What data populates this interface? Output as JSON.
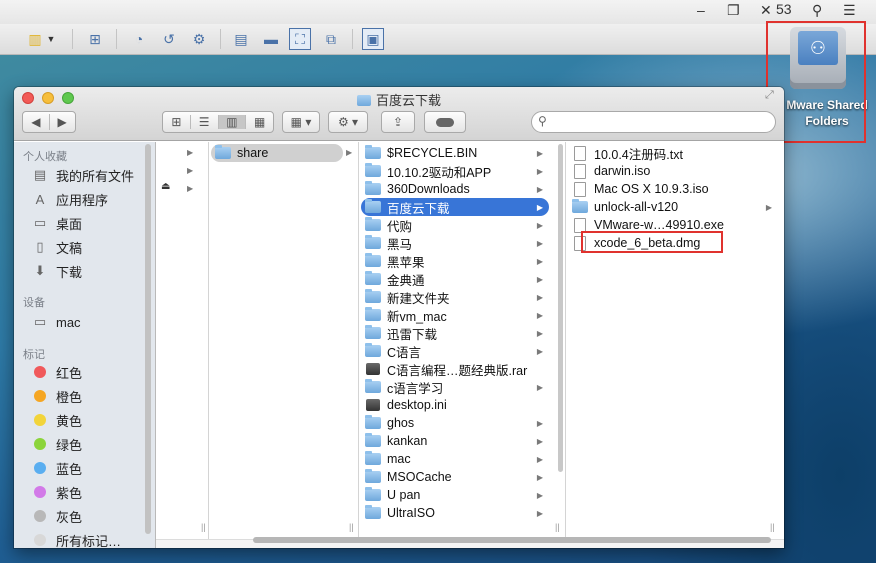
{
  "host": {
    "titlebar_fragment": "53",
    "window_controls": [
      "minimize-icon",
      "restore-icon",
      "close-icon"
    ]
  },
  "desktop_icon": {
    "label_line1": "Mware Shared",
    "label_line2": "Folders"
  },
  "finder": {
    "title": "百度云下载",
    "sidebar": {
      "favorites_heading": "个人收藏",
      "favorites": [
        {
          "label": "我的所有文件",
          "icon": "all-files-icon"
        },
        {
          "label": "应用程序",
          "icon": "applications-icon"
        },
        {
          "label": "桌面",
          "icon": "desktop-icon"
        },
        {
          "label": "文稿",
          "icon": "documents-icon"
        },
        {
          "label": "下载",
          "icon": "downloads-icon"
        }
      ],
      "devices_heading": "设备",
      "devices": [
        {
          "label": "mac",
          "icon": "hard-disk-icon"
        }
      ],
      "tags_heading": "标记",
      "tags": [
        {
          "label": "红色",
          "color": "#f0595b"
        },
        {
          "label": "橙色",
          "color": "#f5a623"
        },
        {
          "label": "黄色",
          "color": "#f2d43a"
        },
        {
          "label": "绿色",
          "color": "#8bd43b"
        },
        {
          "label": "蓝色",
          "color": "#5aaef0"
        },
        {
          "label": "紫色",
          "color": "#d27ae8"
        },
        {
          "label": "灰色",
          "color": "#b8b8b8"
        },
        {
          "label": "所有标记…",
          "color": "#d8d8d8"
        }
      ]
    },
    "column2": [
      {
        "label": "share"
      }
    ],
    "column3": [
      {
        "label": "$RECYCLE.BIN",
        "kind": "folder"
      },
      {
        "label": "10.10.2驱动和APP",
        "kind": "folder"
      },
      {
        "label": "360Downloads",
        "kind": "folder"
      },
      {
        "label": "百度云下载",
        "kind": "folder"
      },
      {
        "label": "代购",
        "kind": "folder"
      },
      {
        "label": "黑马",
        "kind": "folder"
      },
      {
        "label": "黑苹果",
        "kind": "folder"
      },
      {
        "label": "金典通",
        "kind": "folder"
      },
      {
        "label": "新建文件夹",
        "kind": "folder"
      },
      {
        "label": "新vm_mac",
        "kind": "folder"
      },
      {
        "label": "迅雷下载",
        "kind": "folder"
      },
      {
        "label": "C语言",
        "kind": "folder"
      },
      {
        "label": "C语言编程…题经典版.rar",
        "kind": "file"
      },
      {
        "label": "c语言学习",
        "kind": "folder"
      },
      {
        "label": "desktop.ini",
        "kind": "file"
      },
      {
        "label": "ghos",
        "kind": "folder"
      },
      {
        "label": "kankan",
        "kind": "folder"
      },
      {
        "label": "mac",
        "kind": "folder"
      },
      {
        "label": "MSOCache",
        "kind": "folder"
      },
      {
        "label": "U pan",
        "kind": "folder"
      },
      {
        "label": "UltraISO",
        "kind": "folder"
      }
    ],
    "column4": [
      {
        "label": "10.0.4注册码.txt",
        "kind": "doc"
      },
      {
        "label": "darwin.iso",
        "kind": "doc"
      },
      {
        "label": "Mac OS X 10.9.3.iso",
        "kind": "doc"
      },
      {
        "label": "unlock-all-v120",
        "kind": "folder"
      },
      {
        "label": "VMware-w…49910.exe",
        "kind": "doc"
      },
      {
        "label": "xcode_6_beta.dmg",
        "kind": "doc"
      }
    ]
  }
}
